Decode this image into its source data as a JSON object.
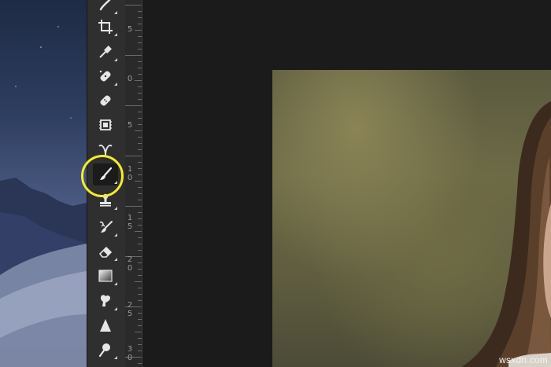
{
  "toolbar": {
    "tools": [
      {
        "name": "brush-tool-partial",
        "icon": "brush-icon"
      },
      {
        "name": "crop-tool",
        "icon": "crop-icon"
      },
      {
        "name": "eyedropper-tool",
        "icon": "eyedropper-icon"
      },
      {
        "name": "spot-healing-tool",
        "icon": "spot-healing-icon"
      },
      {
        "name": "healing-brush-tool",
        "icon": "bandage-icon"
      },
      {
        "name": "patch-tool",
        "icon": "patch-icon"
      },
      {
        "name": "red-eye-tool",
        "icon": "red-eye-icon"
      },
      {
        "name": "brush-tool",
        "icon": "brush-icon",
        "active": true
      },
      {
        "name": "clone-stamp-tool",
        "icon": "stamp-icon"
      },
      {
        "name": "history-brush-tool",
        "icon": "history-brush-icon"
      },
      {
        "name": "eraser-tool",
        "icon": "eraser-icon"
      },
      {
        "name": "gradient-tool",
        "icon": "gradient-icon"
      },
      {
        "name": "smudge-tool",
        "icon": "smudge-icon"
      },
      {
        "name": "sharpen-tool",
        "icon": "triangle-icon"
      },
      {
        "name": "dodge-tool",
        "icon": "dodge-icon"
      }
    ]
  },
  "ruler": {
    "labels": [
      "5",
      "0",
      "5",
      "1\n0",
      "1\n5",
      "2\n0",
      "2\n5",
      "3\n0"
    ]
  },
  "highlight_color": "#f2ee26",
  "watermark": "wsxdn.com"
}
